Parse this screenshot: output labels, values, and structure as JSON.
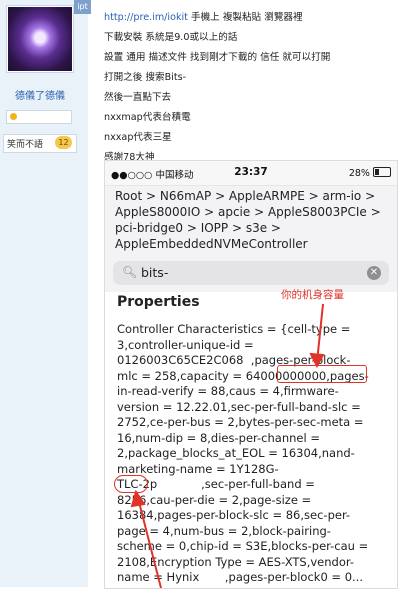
{
  "sidebar": {
    "user_name": "德儀了德儀",
    "tag_label": "笑而不語",
    "tag_count": "12",
    "corner_badge": "ipt"
  },
  "post": {
    "lines": [
      {
        "link": "http://pre.im/iokit",
        "text": " 手機上 複製粘貼 瀏覽器裡"
      },
      {
        "link": "",
        "text": "下載安裝 系統是9.0或以上的話"
      },
      {
        "link": "",
        "text": "設置 通用 描述文件 找到剛才下載的 信任 就可以打開"
      },
      {
        "link": "",
        "text": "打開之後 搜索Bits-"
      },
      {
        "link": "",
        "text": "然後一直點下去"
      },
      {
        "link": "",
        "text": "nxxmap代表台積電"
      },
      {
        "link": "",
        "text": "nxxap代表三星"
      },
      {
        "link": "",
        "text": "感謝78大神"
      }
    ]
  },
  "screenshot": {
    "status": {
      "carrier": "●●○○○ 中国移动",
      "time": "23:37",
      "battery": "28%"
    },
    "path": "Root > N66mAP > AppleARMPE > arm-io > AppleS8000IO > apcie > AppleS8003PCIe > pci-bridge0 > IOPP > s3e > AppleEmbeddedNVMeController",
    "search": {
      "value": "bits-"
    },
    "properties_title": "Properties",
    "annotation": "你的机身容量",
    "properties_text": "Controller Characteristics = {cell-type =\n3,controller-unique-id =\n0126003C65CE2C068  ,pages-per-block-\nmlc = 258,capacity = 64000000000,pages-\nin-read-verify = 88,caus = 4,firmware-\nversion = 12.22.01,sec-per-full-band-slc =\n2752,ce-per-bus = 2,bytes-per-sec-meta =\n16,num-dip = 8,dies-per-channel =\n2,package_blocks_at_EOL = 16304,nand-\nmarketing-name = 1Y128G-\nTLC-2p            ,sec-per-full-band =\n8256,cau-per-die = 2,page-size =\n16384,pages-per-block-slc = 86,sec-per-\npage = 4,num-bus = 2,block-pairing-\nscheme = 0,chip-id = S3E,blocks-per-cau =\n2108,Encryption Type = AES-XTS,vendor-\nname = Hynix       ,pages-per-block0 = 0..."
  },
  "colors": {
    "link": "#2b62b3",
    "annotation": "#e0332a",
    "sidebar_bg": "#eaf2f9"
  }
}
